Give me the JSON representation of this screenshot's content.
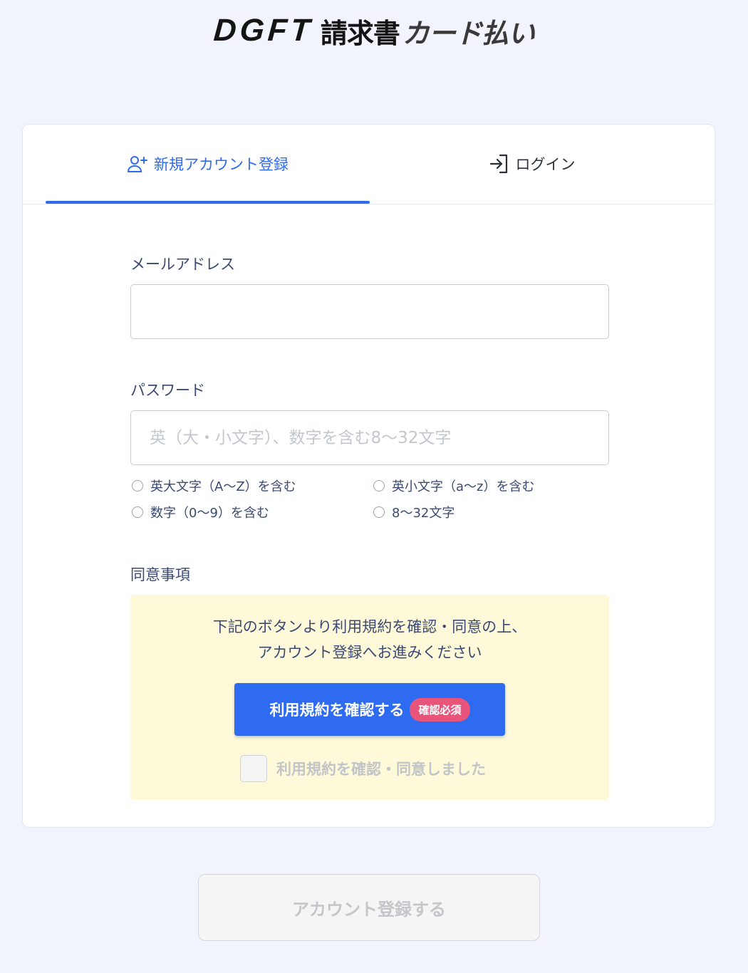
{
  "logo": {
    "latin": "DGFT",
    "ja1": "請求書",
    "ja2": "カード払い"
  },
  "tabs": [
    {
      "label": "新規アカウント登録",
      "active": true,
      "icon": "person-add-icon"
    },
    {
      "label": "ログイン",
      "active": false,
      "icon": "login-icon"
    }
  ],
  "email": {
    "label": "メールアドレス",
    "value": "",
    "placeholder": ""
  },
  "password": {
    "label": "パスワード",
    "value": "",
    "placeholder": "英（大・小文字）、数字を含む8〜32文字",
    "requirements": [
      "英大文字（A〜Z）を含む",
      "英小文字（a〜z）を含む",
      "数字（0〜9）を含む",
      "8〜32文字"
    ]
  },
  "agreement": {
    "label": "同意事項",
    "text_line1": "下記のボタンより利用規約を確認・同意の上、",
    "text_line2": "アカウント登録へお進みください",
    "terms_button": "利用規約を確認する",
    "terms_badge": "確認必須",
    "checkbox_label": "利用規約を確認・同意しました",
    "checked": false
  },
  "submit_label": "アカウント登録する",
  "colors": {
    "accent": "#2f6bf0",
    "badge": "#e9547a",
    "agree_bg": "#fefad9",
    "page_bg": "#f1f4fd"
  }
}
